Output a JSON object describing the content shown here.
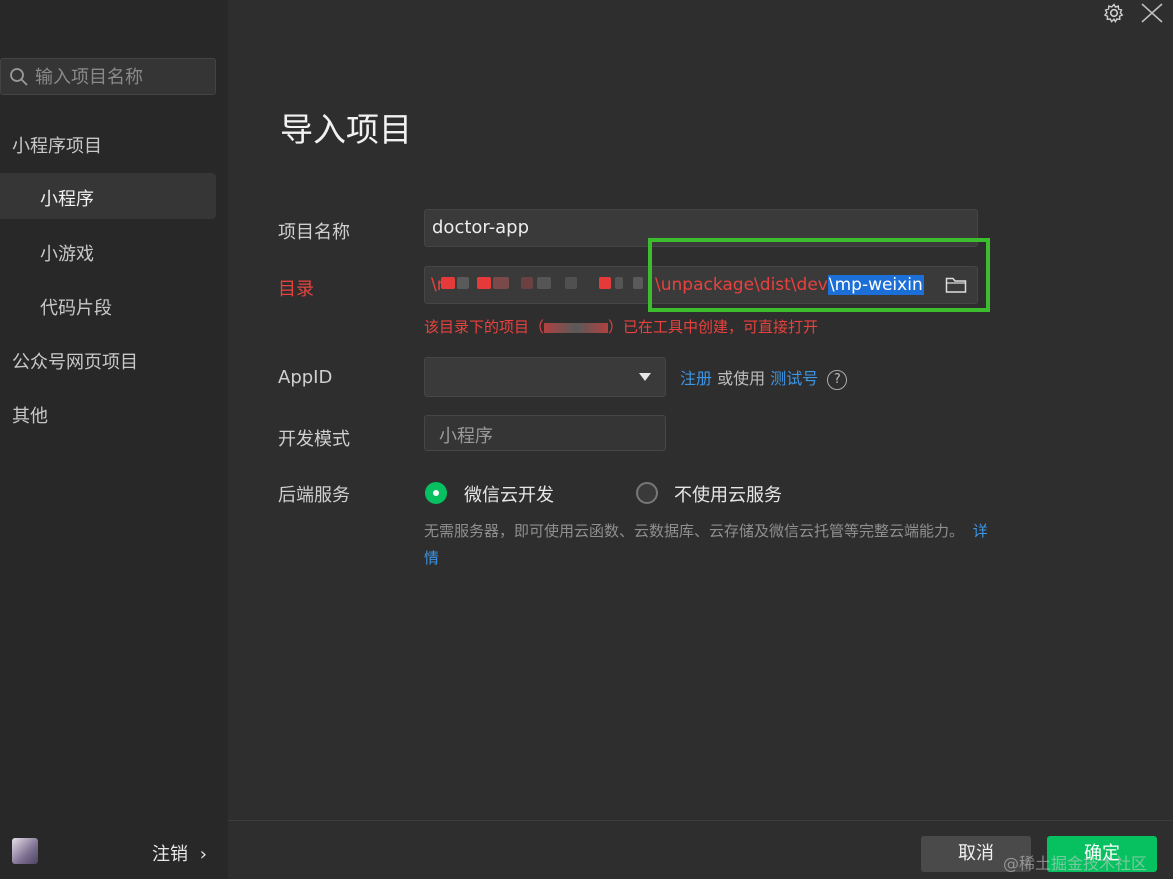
{
  "sidebar": {
    "search_placeholder": "输入项目名称",
    "groups": [
      {
        "label": "小程序项目"
      },
      {
        "label": "公众号网页项目"
      },
      {
        "label": "其他"
      }
    ],
    "items": [
      {
        "label": "小程序"
      },
      {
        "label": "小游戏"
      },
      {
        "label": "代码片段"
      }
    ],
    "logout_label": "注销",
    "logout_chevron": "›"
  },
  "main": {
    "title": "导入项目",
    "project_name_label": "项目名称",
    "project_name_value": "doctor-app",
    "dir_label": "目录",
    "dir_prefix": "\\r",
    "dir_visible_path": "\\unpackage\\dist\\dev",
    "dir_selected": "\\mp-weixin",
    "dir_hint_prefix": "该目录下的项目（",
    "dir_hint_suffix": "）已在工具中创建，可直接打开",
    "appid_label": "AppID",
    "appid_value": "",
    "appid_register": "注册",
    "appid_or_use": "或使用",
    "appid_test": "测试号",
    "appid_help": "?",
    "dev_mode_label": "开发模式",
    "dev_mode_value": "小程序",
    "backend_label": "后端服务",
    "backend_options": [
      {
        "label": "微信云开发",
        "selected": true
      },
      {
        "label": "不使用云服务",
        "selected": false
      }
    ],
    "backend_desc": "无需服务器，即可使用云函数、云数据库、云存储及微信云托管等完整云端能力。",
    "backend_detail_link": "详情"
  },
  "footer": {
    "cancel_label": "取消",
    "ok_label": "确定"
  },
  "watermark": "@稀土掘金技术社区",
  "colors": {
    "accent_green": "#07c160",
    "error_red": "#e8423e",
    "link_blue": "#3d95e6",
    "highlight_box": "#3bbd2d",
    "selection_blue": "#1d6fd8"
  }
}
